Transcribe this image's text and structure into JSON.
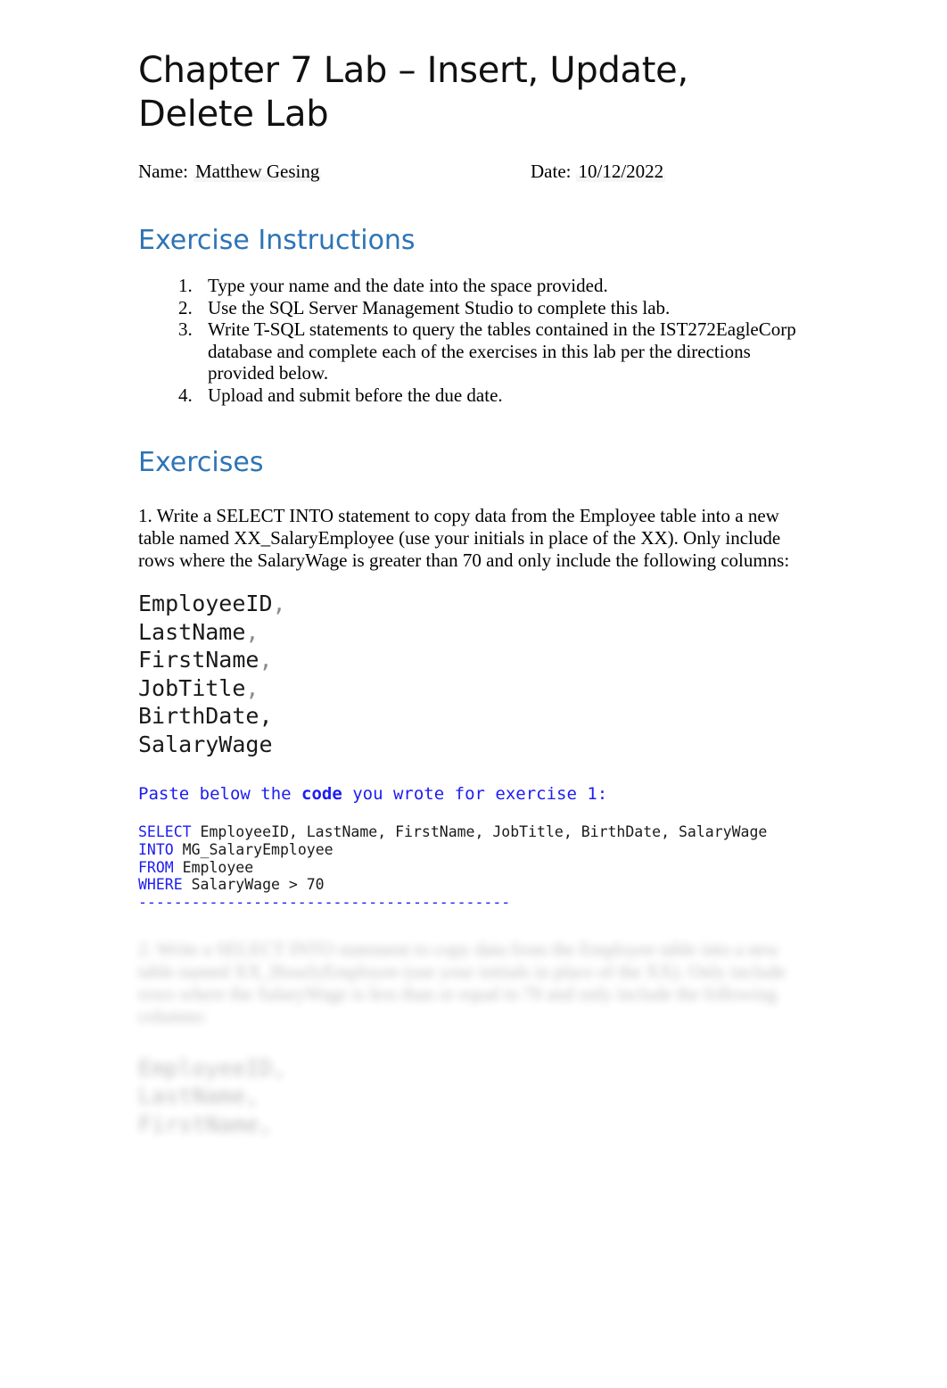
{
  "document": {
    "title": "Chapter 7 Lab – Insert, Update, Delete Lab",
    "name_label": "Name:",
    "name_value": "Matthew Gesing",
    "date_label": "Date:",
    "date_value": "10/12/2022"
  },
  "instructions": {
    "heading": "Exercise Instructions",
    "items": [
      "Type your name and the date into the space provided.",
      "Use the SQL Server Management Studio to complete this lab.",
      "Write T-SQL statements to query the tables contained in the IST272EagleCorp database and complete each of the exercises in this lab per the directions provided below.",
      "Upload and submit before the due date."
    ]
  },
  "exercises": {
    "heading": "Exercises",
    "ex1": {
      "prompt": "1. Write a SELECT INTO statement to copy data from the Employee table into a new table named XX_SalaryEmployee (use your initials in place of the XX). Only include rows where the SalaryWage is greater than 70 and only include the following columns:",
      "columns": [
        {
          "name": "EmployeeID",
          "comma": ","
        },
        {
          "name": "LastName",
          "comma": ","
        },
        {
          "name": "FirstName",
          "comma": ","
        },
        {
          "name": "JobTitle",
          "comma": ","
        },
        {
          "name": "BirthDate",
          "comma": ","
        },
        {
          "name": "SalaryWage",
          "comma": ""
        }
      ],
      "paste_prompt_before": "Paste below the ",
      "paste_prompt_bold": "code",
      "paste_prompt_after": " you wrote for exercise 1:",
      "code": {
        "line1_kw": "SELECT",
        "line1_rest": " EmployeeID, LastName, FirstName, JobTitle, BirthDate, SalaryWage",
        "line2_kw": "INTO",
        "line2_rest": " MG_SalaryEmployee",
        "line3_kw": "FROM",
        "line3_rest": " Employee",
        "line4_kw": "WHERE",
        "line4_rest": " SalaryWage > 70",
        "separator": "------------------------------------------"
      }
    },
    "ex2_faded": {
      "prompt": "2. Write a SELECT INTO statement to copy data from the Employee table into a new table named XX_HourlyEmployee (use your initials in place of the XX). Only include rows where the SalaryWage is less than or equal to 70 and only include the following columns:",
      "columns": [
        "EmployeeID,",
        "LastName,",
        "FirstName,"
      ]
    }
  },
  "colors": {
    "heading_blue": "#2E74B5",
    "code_blue": "#1d1df0",
    "text_black": "#000000",
    "page_background": "#ffffff"
  }
}
